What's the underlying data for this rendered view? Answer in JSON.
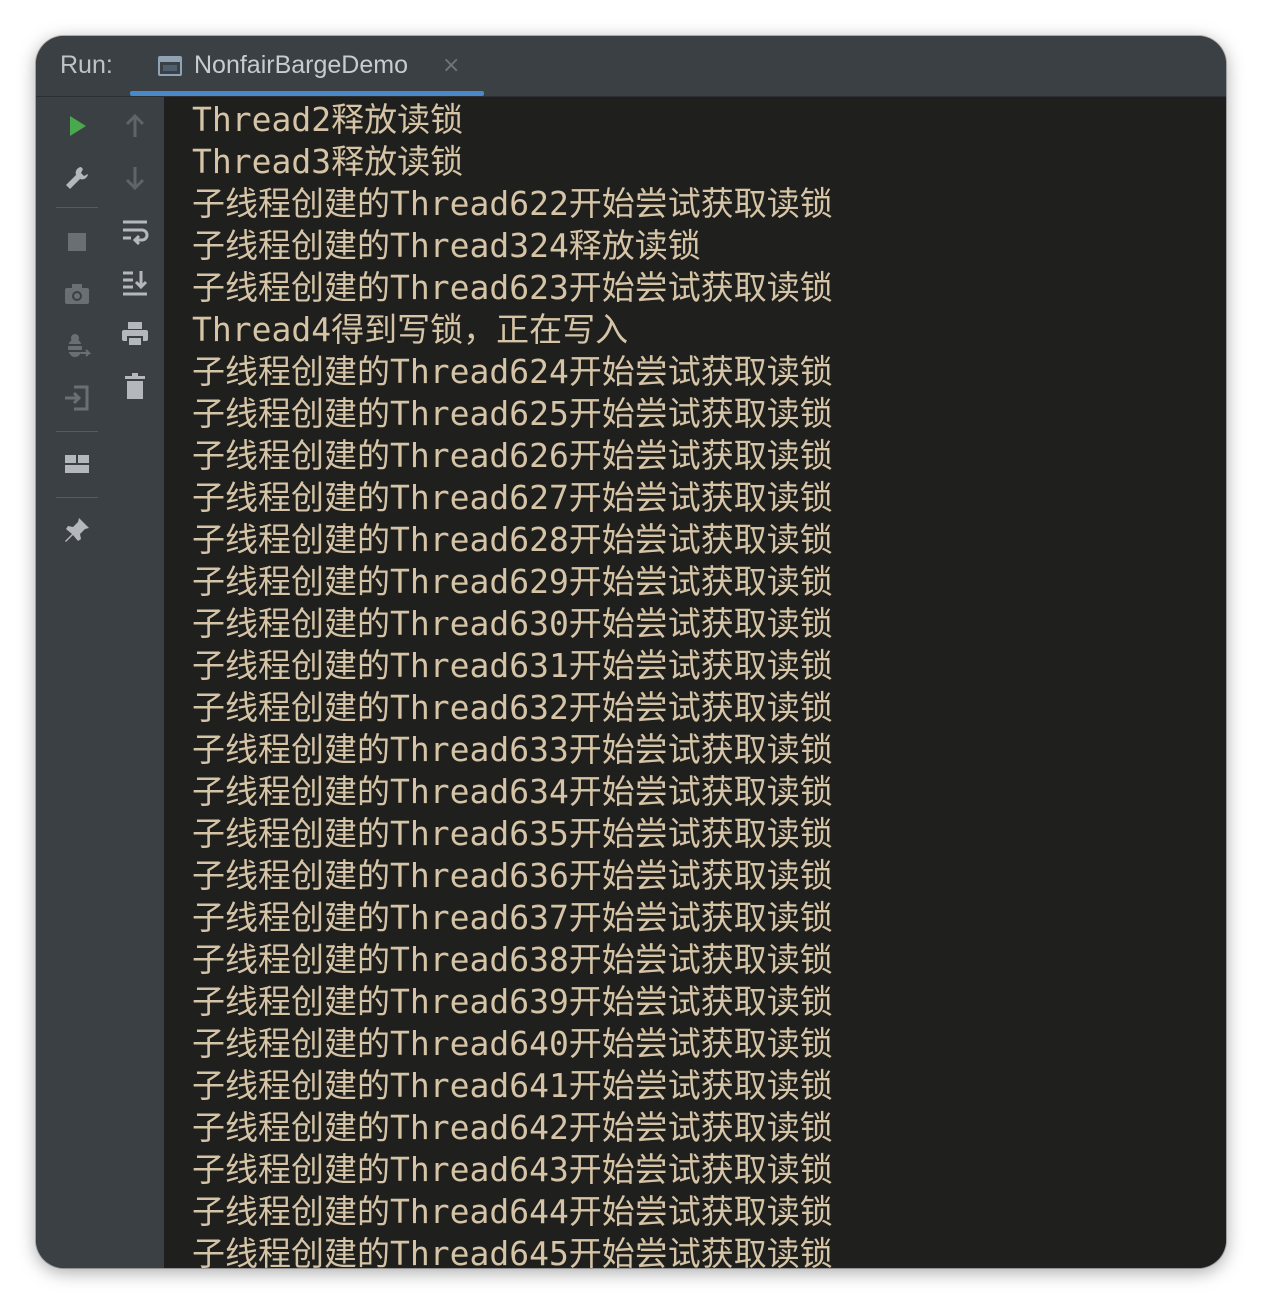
{
  "run_panel": {
    "label": "Run:",
    "tab_title": "NonfairBargeDemo",
    "tab_close": "×"
  },
  "colors": {
    "console_bg": "#1f1f1d",
    "console_text": "#d6c4a6",
    "toolbar_bg": "#3b4045",
    "tab_underline": "#4a88c7",
    "run_green": "#4aa84d"
  },
  "icons": {
    "left_toolbar": [
      "run-icon",
      "wrench-icon",
      "stop-icon",
      "camera-icon",
      "debug-icon",
      "exit-icon",
      "layout-icon",
      "pin-icon"
    ],
    "right_toolbar": [
      "arrow-up-icon",
      "arrow-down-icon",
      "soft-wrap-icon",
      "scroll-to-end-icon",
      "print-icon",
      "trash-icon"
    ]
  },
  "console": {
    "lines": [
      "Thread2释放读锁",
      "Thread3释放读锁",
      "子线程创建的Thread622开始尝试获取读锁",
      "子线程创建的Thread324释放读锁",
      "子线程创建的Thread623开始尝试获取读锁",
      "Thread4得到写锁，正在写入",
      "子线程创建的Thread624开始尝试获取读锁",
      "子线程创建的Thread625开始尝试获取读锁",
      "子线程创建的Thread626开始尝试获取读锁",
      "子线程创建的Thread627开始尝试获取读锁",
      "子线程创建的Thread628开始尝试获取读锁",
      "子线程创建的Thread629开始尝试获取读锁",
      "子线程创建的Thread630开始尝试获取读锁",
      "子线程创建的Thread631开始尝试获取读锁",
      "子线程创建的Thread632开始尝试获取读锁",
      "子线程创建的Thread633开始尝试获取读锁",
      "子线程创建的Thread634开始尝试获取读锁",
      "子线程创建的Thread635开始尝试获取读锁",
      "子线程创建的Thread636开始尝试获取读锁",
      "子线程创建的Thread637开始尝试获取读锁",
      "子线程创建的Thread638开始尝试获取读锁",
      "子线程创建的Thread639开始尝试获取读锁",
      "子线程创建的Thread640开始尝试获取读锁",
      "子线程创建的Thread641开始尝试获取读锁",
      "子线程创建的Thread642开始尝试获取读锁",
      "子线程创建的Thread643开始尝试获取读锁",
      "子线程创建的Thread644开始尝试获取读锁",
      "子线程创建的Thread645开始尝试获取读锁"
    ]
  }
}
